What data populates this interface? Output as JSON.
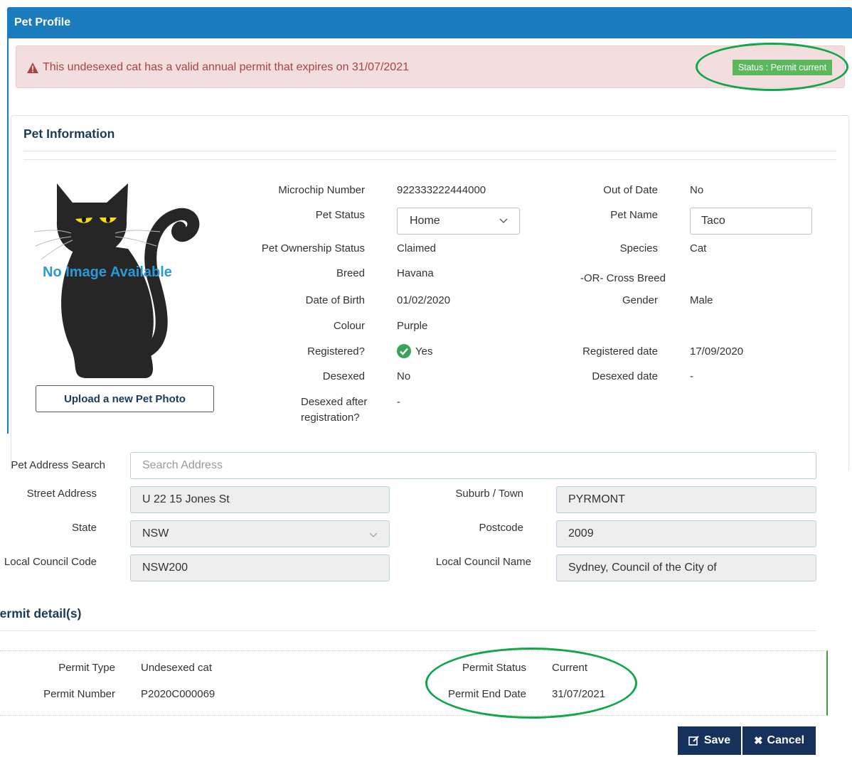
{
  "header": {
    "title": "Pet Profile"
  },
  "alert": {
    "message": "This undesexed cat has a valid annual permit that expires on 31/07/2021",
    "status_badge": "Status : Permit current"
  },
  "pet_info": {
    "section_title": "Pet Information",
    "photo_placeholder": "No Image Available",
    "upload_button": "Upload a new Pet Photo",
    "left_fields": [
      {
        "label": "Microchip Number",
        "value": "922333222444000"
      },
      {
        "label": "Pet Status",
        "value": "Home"
      },
      {
        "label": "Pet Ownership Status",
        "value": "Claimed"
      },
      {
        "label": "Breed",
        "value": "Havana"
      },
      {
        "label": "Date of Birth",
        "value": "01/02/2020"
      },
      {
        "label": "Colour",
        "value": "Purple"
      },
      {
        "label": "Registered?",
        "value": "Yes"
      },
      {
        "label": "Desexed",
        "value": "No"
      },
      {
        "label_line1": "Desexed after",
        "label_line2": "registration?",
        "value": "-"
      }
    ],
    "right_fields": [
      {
        "label": "Out of Date",
        "value": "No"
      },
      {
        "label": "Pet Name",
        "value": "Taco"
      },
      {
        "label": "Species",
        "value": "Cat"
      },
      {
        "label": "-OR- Cross Breed",
        "value": ""
      },
      {
        "label": "Gender",
        "value": "Male"
      },
      {
        "label": "Registered date",
        "value": "17/09/2020"
      },
      {
        "label": "Desexed date",
        "value": "-"
      }
    ]
  },
  "address": {
    "search_label": "Pet Address Search",
    "search_placeholder": "Search Address",
    "street_label": "Street Address",
    "street_value": "U 22 15 Jones St",
    "suburb_label": "Suburb / Town",
    "suburb_value": "PYRMONT",
    "state_label": "State",
    "state_value": "NSW",
    "postcode_label": "Postcode",
    "postcode_value": "2009",
    "council_code_label": "Local Council Code",
    "council_code_value": "NSW200",
    "council_name_label": "Local Council Name",
    "council_name_value": "Sydney, Council of the City of"
  },
  "permit": {
    "section_title": "Permit detail(s)",
    "type_label": "Permit Type",
    "type_value": "Undesexed cat",
    "number_label": "Permit Number",
    "number_value": "P2020C000069",
    "status_label": "Permit Status",
    "status_value": "Current",
    "end_date_label": "Permit End Date",
    "end_date_value": "31/07/2021"
  },
  "actions": {
    "save": "Save",
    "cancel": "Cancel"
  },
  "colors": {
    "header": "#1a7bbd",
    "alert_bg": "#f2dede",
    "alert_text": "#a94442",
    "badge": "#5cb85c",
    "button": "#16325c",
    "annotation": "#12a64a"
  }
}
